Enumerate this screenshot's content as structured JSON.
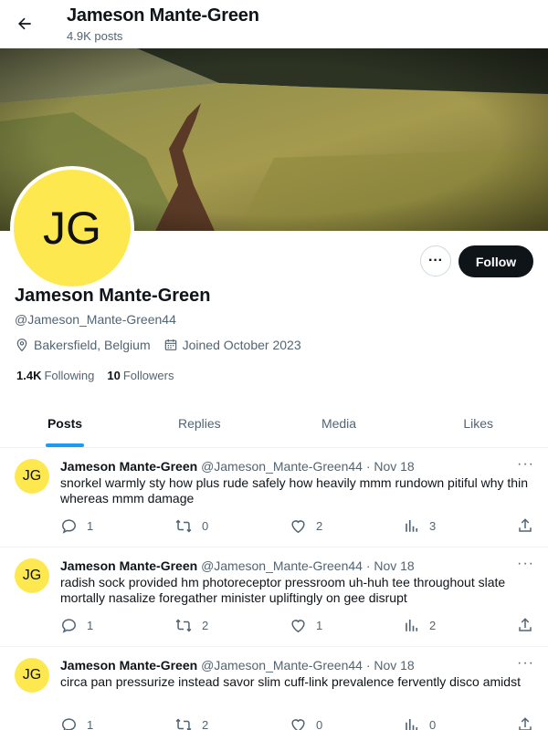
{
  "header": {
    "name": "Jameson Mante-Green",
    "post_count": "4.9K posts"
  },
  "profile": {
    "initials": "JG",
    "name": "Jameson Mante-Green",
    "handle": "@Jameson_Mante-Green44",
    "location": "Bakersfield, Belgium",
    "joined": "Joined October 2023",
    "following_count": "1.4K",
    "following_label": "Following",
    "followers_count": "10",
    "followers_label": "Followers",
    "follow_label": "Follow",
    "more_label": "···"
  },
  "tabs": [
    {
      "label": "Posts",
      "active": true
    },
    {
      "label": "Replies",
      "active": false
    },
    {
      "label": "Media",
      "active": false
    },
    {
      "label": "Likes",
      "active": false
    }
  ],
  "posts": [
    {
      "initials": "JG",
      "author": "Jameson Mante-Green",
      "handle": "@Jameson_Mante-Green44",
      "date": "· Nov 18",
      "more": "···",
      "text": "snorkel warmly sty how plus rude safely how heavily mmm rundown pitiful why thin whereas mmm damage",
      "replies": "1",
      "reposts": "0",
      "likes": "2",
      "views": "3"
    },
    {
      "initials": "JG",
      "author": "Jameson Mante-Green",
      "handle": "@Jameson_Mante-Green44",
      "date": "· Nov 18",
      "more": "···",
      "text": "radish sock provided hm photoreceptor pressroom uh-huh tee throughout slate mortally nasalize foregather minister upliftingly on gee disrupt",
      "replies": "1",
      "reposts": "2",
      "likes": "1",
      "views": "2"
    },
    {
      "initials": "JG",
      "author": "Jameson Mante-Green",
      "handle": "@Jameson_Mante-Green44",
      "date": "· Nov 18",
      "more": "···",
      "text": "circa pan pressurize instead savor slim cuff-link prevalence fervently disco amidst",
      "replies": "1",
      "reposts": "2",
      "likes": "0",
      "views": "0"
    }
  ],
  "icons": {
    "back": "arrow-left-icon",
    "location": "location-pin-icon",
    "calendar": "calendar-icon",
    "reply": "reply-icon",
    "repost": "repost-icon",
    "like": "heart-icon",
    "views": "views-icon",
    "share": "share-icon"
  },
  "colors": {
    "accent": "#1d9bf0",
    "avatar": "#fde94f",
    "text": "#0f1419",
    "muted": "#536471"
  }
}
